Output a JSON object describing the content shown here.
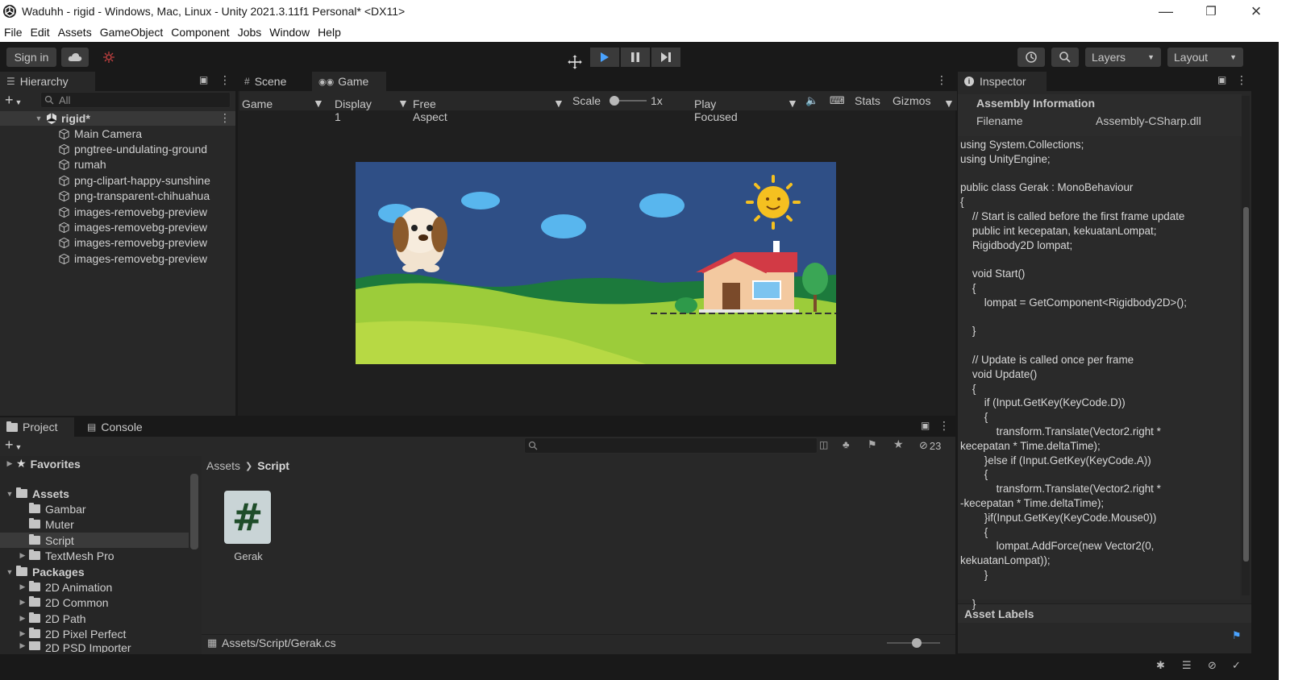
{
  "window": {
    "title": "Waduhh - rigid - Windows, Mac, Linux - Unity 2021.3.11f1 Personal* <DX11>",
    "controls": [
      "minimize",
      "restore",
      "close"
    ]
  },
  "menu": [
    "File",
    "Edit",
    "Assets",
    "GameObject",
    "Component",
    "Jobs",
    "Window",
    "Help"
  ],
  "toolbar": {
    "sign_in": "Sign in",
    "layers": "Layers",
    "layout": "Layout"
  },
  "hierarchy": {
    "tab": "Hierarchy",
    "search_placeholder": "All",
    "scene": "rigid*",
    "items": [
      "Main Camera",
      "pngtree-undulating-ground",
      "rumah",
      "png-clipart-happy-sunshine",
      "png-transparent-chihuahua",
      "images-removebg-preview",
      "images-removebg-preview",
      "images-removebg-preview",
      "images-removebg-preview"
    ]
  },
  "center": {
    "tabs": [
      "Scene",
      "Game"
    ],
    "active_tab": "Game",
    "game_mode": "Game",
    "display": "Display 1",
    "aspect": "Free Aspect",
    "scale_label": "Scale",
    "scale_value": "1x",
    "play_mode": "Play Focused",
    "stats": "Stats",
    "gizmos": "Gizmos"
  },
  "inspector": {
    "tab": "Inspector",
    "section": "Assembly Information",
    "filename_label": "Filename",
    "filename_value": "Assembly-CSharp.dll",
    "code": "using System.Collections;\nusing UnityEngine;\n\npublic class Gerak : MonoBehaviour\n{\n    // Start is called before the first frame update\n    public int kecepatan, kekuatanLompat;\n    Rigidbody2D lompat;\n\n    void Start()\n    {\n        lompat = GetComponent<Rigidbody2D>();\n\n    }\n\n    // Update is called once per frame\n    void Update()\n    {\n        if (Input.GetKey(KeyCode.D))\n        {\n            transform.Translate(Vector2.right *\nkecepatan * Time.deltaTime);\n        }else if (Input.GetKey(KeyCode.A))\n        {\n            transform.Translate(Vector2.right *\n-kecepatan * Time.deltaTime);\n        }if(Input.GetKey(KeyCode.Mouse0))\n        {\n            lompat.AddForce(new Vector2(0,\nkekuatanLompat));\n        }\n\n    }",
    "asset_labels": "Asset Labels"
  },
  "project": {
    "tabs": [
      "Project",
      "Console"
    ],
    "hidden_count": "23",
    "favorites": "Favorites",
    "assets": "Assets",
    "asset_folders": [
      "Gambar",
      "Muter",
      "Script",
      "TextMesh Pro"
    ],
    "packages": "Packages",
    "package_folders": [
      "2D Animation",
      "2D Common",
      "2D Path",
      "2D Pixel Perfect",
      "2D PSD Importer"
    ],
    "breadcrumb": [
      "Assets",
      "Script"
    ],
    "file_name": "Gerak",
    "file_symbol": "#",
    "status_path": "Assets/Script/Gerak.cs"
  },
  "colors": {
    "play_blue": "#4aa3ff",
    "panel_bg": "#282828",
    "header_bg": "#191919",
    "game_sky": "#2f4f86",
    "game_grass": "#9ccc3a"
  }
}
